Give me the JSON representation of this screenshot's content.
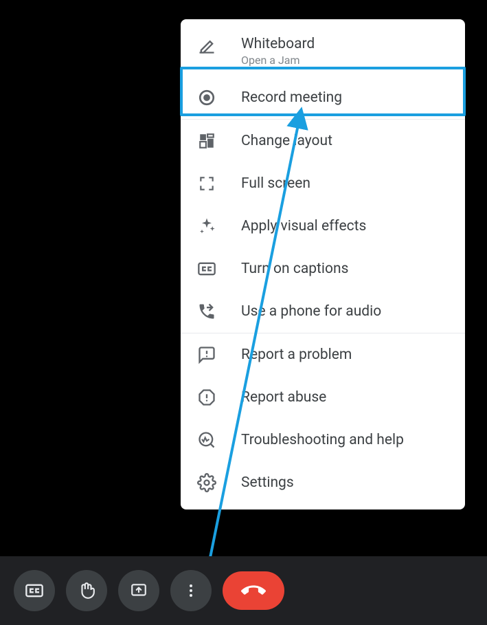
{
  "menu": {
    "whiteboard": {
      "label": "Whiteboard",
      "subtitle": "Open a Jam"
    },
    "record": {
      "label": "Record meeting"
    },
    "layout": {
      "label": "Change layout"
    },
    "fullscreen": {
      "label": "Full screen"
    },
    "effects": {
      "label": "Apply visual effects"
    },
    "captions": {
      "label": "Turn on captions"
    },
    "phone": {
      "label": "Use a phone for audio"
    },
    "report_problem": {
      "label": "Report a problem"
    },
    "report_abuse": {
      "label": "Report abuse"
    },
    "troubleshoot": {
      "label": "Troubleshooting and help"
    },
    "settings": {
      "label": "Settings"
    }
  },
  "annotation": {
    "highlight_color": "#1a9fe0"
  }
}
